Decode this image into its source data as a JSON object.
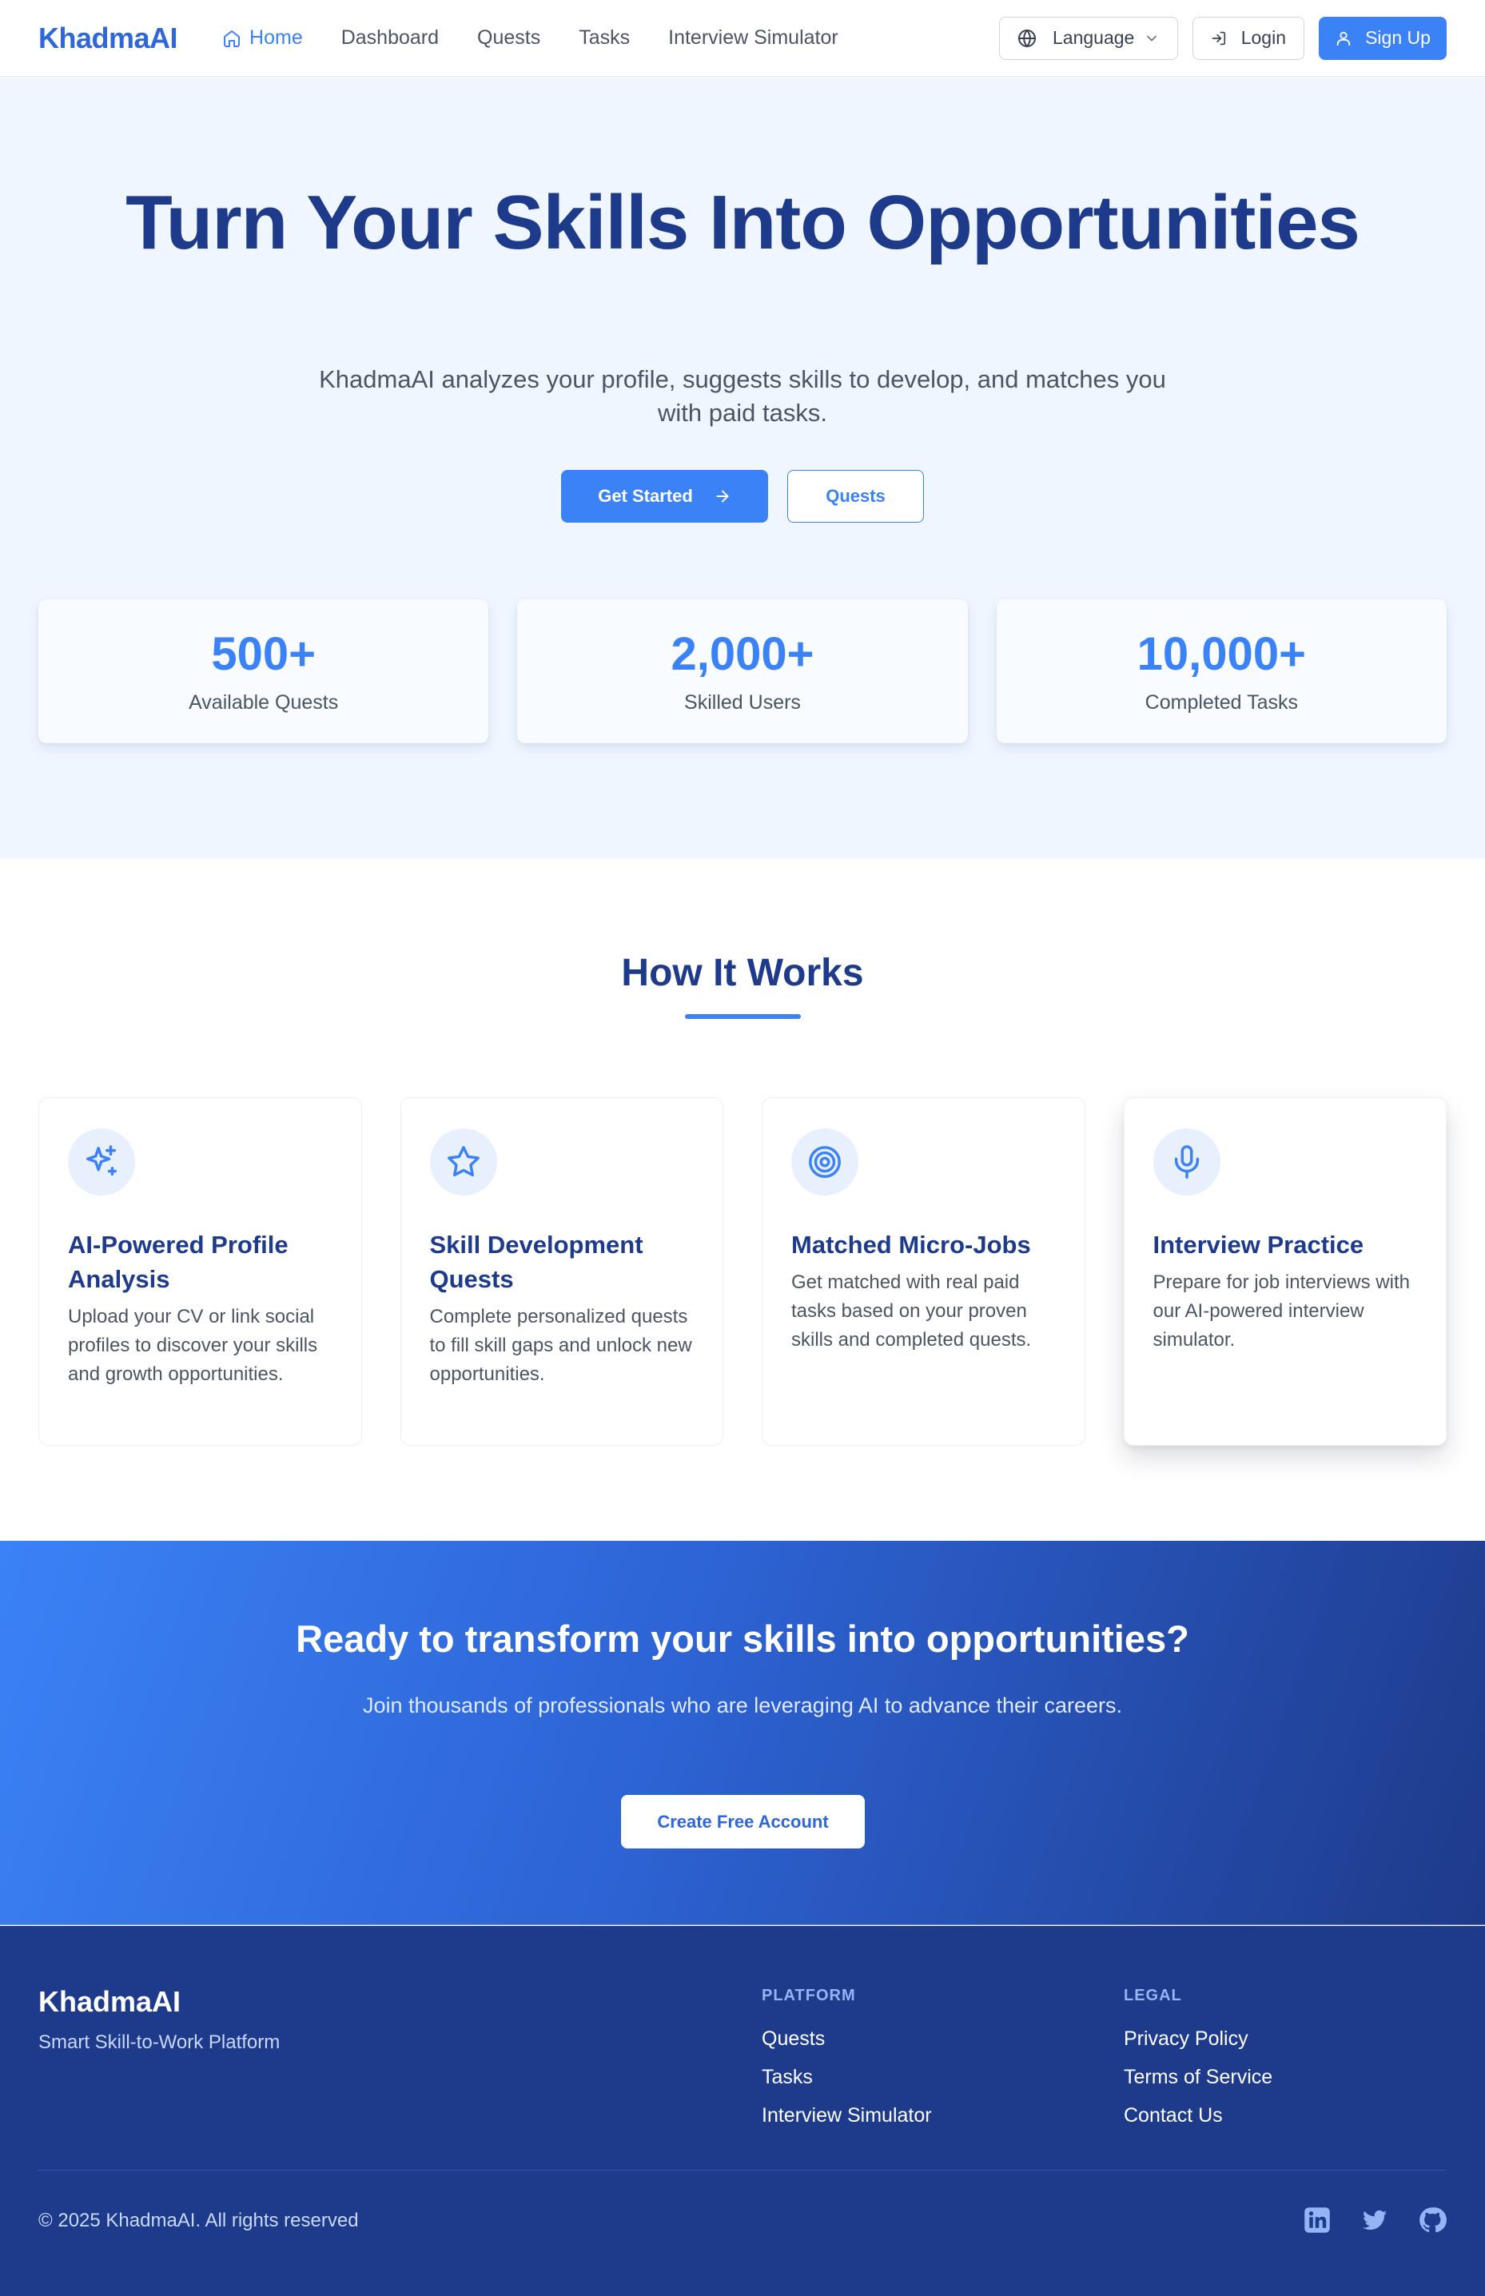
{
  "nav": {
    "brand": "KhadmaAI",
    "links": [
      "Home",
      "Dashboard",
      "Quests",
      "Tasks",
      "Interview Simulator"
    ],
    "language_label": "Language",
    "login_label": "Login",
    "signup_label": "Sign Up"
  },
  "hero": {
    "title": "Turn Your Skills Into Opportunities",
    "subtitle": "KhadmaAI analyzes your profile, suggests skills to develop, and matches you with paid tasks.",
    "primary_cta": "Get Started",
    "secondary_cta": "Quests",
    "stats": [
      {
        "value": "500+",
        "label": "Available Quests"
      },
      {
        "value": "2,000+",
        "label": "Skilled Users"
      },
      {
        "value": "10,000+",
        "label": "Completed Tasks"
      }
    ]
  },
  "how": {
    "title": "How It Works",
    "cards": [
      {
        "icon": "sparkles-icon",
        "title": "AI-Powered Profile Analysis",
        "text": "Upload your CV or link social profiles to discover your skills and growth opportunities."
      },
      {
        "icon": "star-icon",
        "title": "Skill Development Quests",
        "text": "Complete personalized quests to fill skill gaps and unlock new opportunities."
      },
      {
        "icon": "target-icon",
        "title": "Matched Micro-Jobs",
        "text": "Get matched with real paid tasks based on your proven skills and completed quests."
      },
      {
        "icon": "microphone-icon",
        "title": "Interview Practice",
        "text": "Prepare for job interviews with our AI-powered interview simulator."
      }
    ]
  },
  "cta": {
    "title": "Ready to transform your skills into opportunities?",
    "text": "Join thousands of professionals who are leveraging AI to advance their careers.",
    "button": "Create Free Account"
  },
  "footer": {
    "brand": "KhadmaAI",
    "tagline": "Smart Skill-to-Work Platform",
    "platform": {
      "heading": "PLATFORM",
      "links": [
        "Quests",
        "Tasks",
        "Interview Simulator"
      ]
    },
    "legal": {
      "heading": "LEGAL",
      "links": [
        "Privacy Policy",
        "Terms of Service",
        "Contact Us"
      ]
    },
    "copyright": "© 2025 KhadmaAI. All rights reserved",
    "social": [
      "linkedin-icon",
      "twitter-icon",
      "github-icon"
    ]
  },
  "colors": {
    "accent": "#3b82f6",
    "heading": "#1e3a8a",
    "hero_bg": "#eff6ff",
    "footer_bg": "#1e3a8a"
  }
}
